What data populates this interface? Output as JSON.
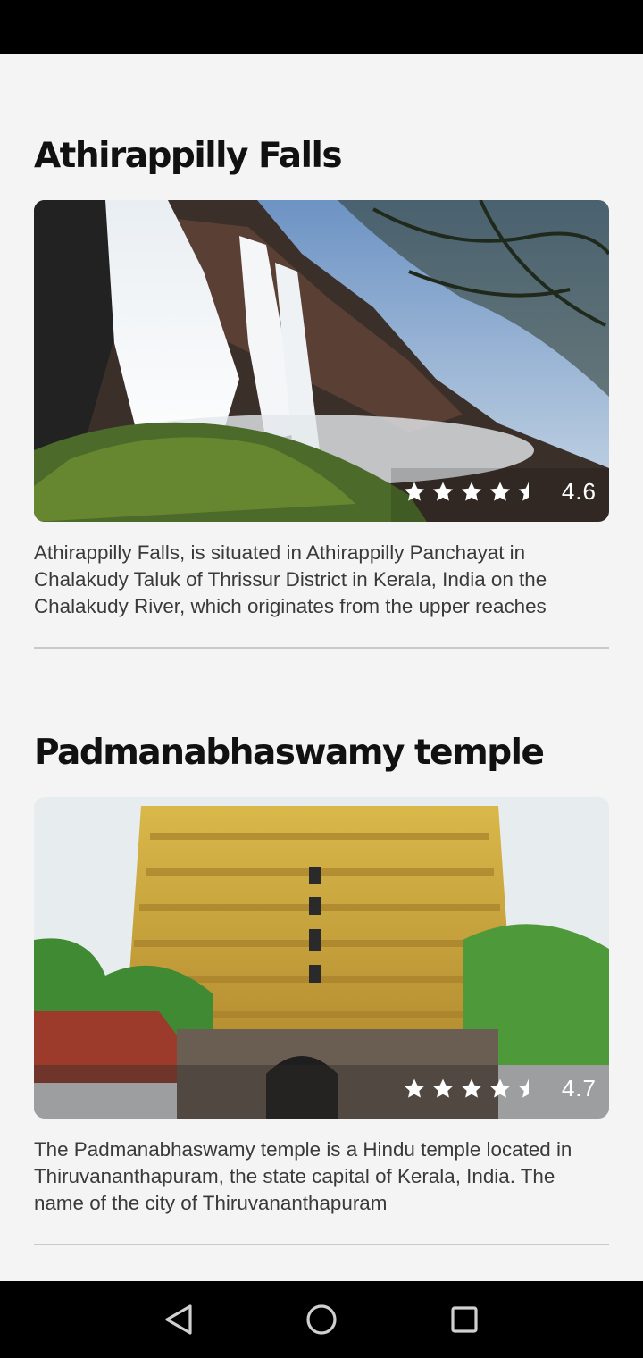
{
  "places": [
    {
      "title": "Athirappilly Falls",
      "rating": "4.6",
      "rating_value": 4.6,
      "description": "Athirappilly Falls, is situated in Athirappilly Panchayat in Chalakudy Taluk of Thrissur District in Kerala, India on the Chalakudy River, which originates from the upper reaches"
    },
    {
      "title": "Padmanabhaswamy temple",
      "rating": "4.7",
      "rating_value": 4.7,
      "description": "The Padmanabhaswamy temple is a Hindu temple located in Thiruvananthapuram, the state capital of Kerala, India. The name of the city of Thiruvananthapuram"
    }
  ],
  "nav": {
    "back_icon": "back-triangle-icon",
    "home_icon": "home-circle-icon",
    "recents_icon": "recents-square-icon"
  },
  "colors": {
    "background": "#f4f4f4",
    "text": "#111111",
    "description": "#3a3a3a",
    "divider": "#c9c9c9"
  }
}
